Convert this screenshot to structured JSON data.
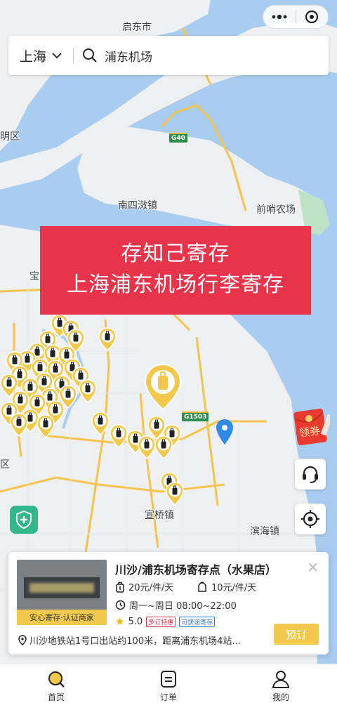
{
  "map": {
    "labels": {
      "qidong": "启东市",
      "district_cut": "明区",
      "nansi": "南四滧镇",
      "qianshao": "前哨农场",
      "bao": "宝",
      "qu": "区",
      "xuanqiao": "宣桥镇",
      "binhai": "滨海镇"
    },
    "road_badges": {
      "g40": "G40",
      "g1503": "G1503"
    }
  },
  "search": {
    "city": "上海",
    "query": "浦东机场"
  },
  "banner": {
    "line1": "存知己寄存",
    "line2": "上海浦东机场行李寄存"
  },
  "coupon": {
    "label": "领券"
  },
  "card": {
    "title": "川沙/浦东机场寄存点（水果店）",
    "thumb_tag": "安心寄存·认证商家",
    "price_luggage": "20元/件/天",
    "price_bag": "10元/件/天",
    "hours": "周一~周日 08:00~22:00",
    "rating": "5.0",
    "tag1": "多订特惠",
    "tag2": "可快递寄存",
    "reserve_label": "预订",
    "address": "川沙地铁站1号口出站约100米，距离浦东机场4站..."
  },
  "tabbar": {
    "home": "首页",
    "orders": "订单",
    "mine": "我的"
  },
  "colors": {
    "accent_yellow": "#f2c94c",
    "banner_red": "#e8344a",
    "water": "#a9ccf1",
    "shield_green": "#34b58a"
  }
}
